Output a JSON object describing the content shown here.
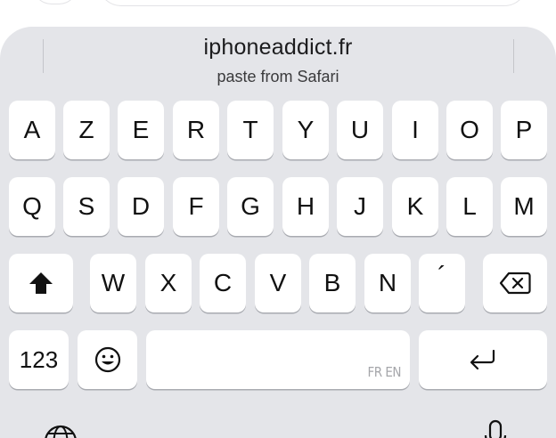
{
  "suggestion": {
    "main": "iphoneaddict.fr",
    "sub": "paste from Safari"
  },
  "rows": {
    "row1": [
      "A",
      "Z",
      "E",
      "R",
      "T",
      "Y",
      "U",
      "I",
      "O",
      "P"
    ],
    "row2": [
      "Q",
      "S",
      "D",
      "F",
      "G",
      "H",
      "J",
      "K",
      "L",
      "M"
    ],
    "row3": [
      "W",
      "X",
      "C",
      "V",
      "B",
      "N",
      "´"
    ]
  },
  "bottom": {
    "numbers_label": "123",
    "space_hint": "FR EN"
  },
  "icons": {
    "shift": "shift-icon",
    "delete": "delete-icon",
    "emoji": "emoji-icon",
    "return": "return-icon",
    "globe": "globe-icon",
    "mic": "microphone-icon"
  },
  "colors": {
    "keyboard_bg": "#e4e5e9",
    "key_bg": "#ffffff"
  }
}
